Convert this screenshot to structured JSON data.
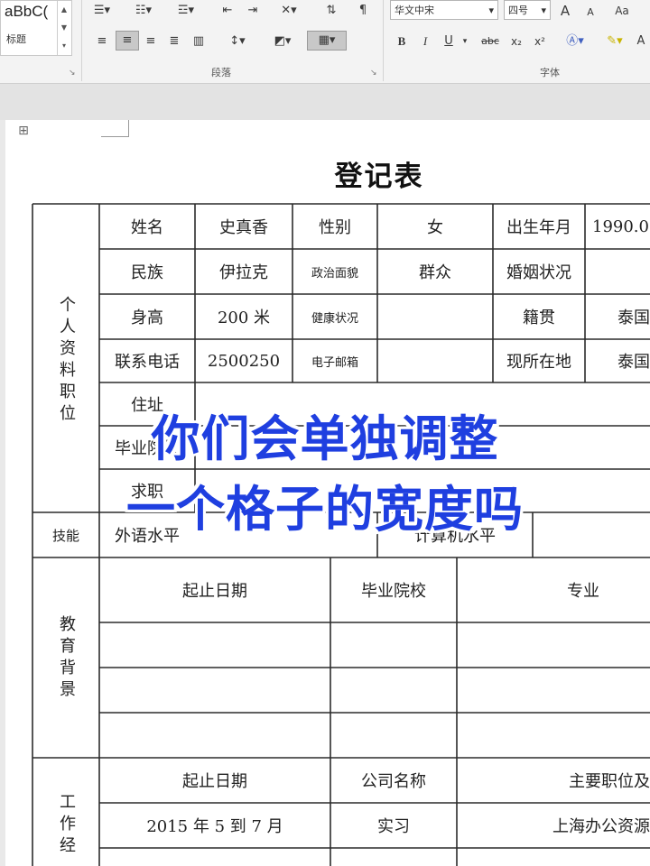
{
  "ribbon": {
    "style_gallery": {
      "sample": "aBbC(",
      "name": "标题"
    },
    "font": {
      "name": "华文中宋",
      "size": "四号"
    },
    "format_buttons": {
      "bold": "B",
      "italic": "I",
      "underline": "U",
      "strike": "abc",
      "subscript": "x₂",
      "superscript": "x²",
      "grow": "A",
      "shrink": "A",
      "case": "Aa"
    },
    "group_labels": {
      "paragraph": "段落",
      "font": "字体"
    }
  },
  "document": {
    "title": "登记表",
    "sections": {
      "personal": "个人资料职位",
      "skills": "技能",
      "education": "教育背景",
      "work": "工作经"
    },
    "personal_rows": [
      {
        "l1": "姓名",
        "v1": "史真香",
        "l2": "性别",
        "v2": "女",
        "l3": "出生年月",
        "v3": "1990.0"
      },
      {
        "l1": "民族",
        "v1": "伊拉克",
        "l2": "政治面貌",
        "v2": "群众",
        "l3": "婚姻状况",
        "v3": ""
      },
      {
        "l1": "身高",
        "v1": "200 米",
        "l2": "健康状况",
        "v2": "",
        "l3": "籍贯",
        "v3": "泰国"
      },
      {
        "l1": "联系电话",
        "v1": "2500250",
        "l2": "电子邮箱",
        "v2": "",
        "l3": "现所在地",
        "v3": "泰国"
      }
    ],
    "partial_rows": [
      "住址",
      "毕业院校",
      "求职"
    ],
    "skills_row": {
      "foreign": "外语水平",
      "computer": "计算机水平"
    },
    "education_headers": [
      "起止日期",
      "毕业院校",
      "专业"
    ],
    "work_headers": [
      "起止日期",
      "公司名称",
      "主要职位及"
    ],
    "work_rows": [
      {
        "date": "2015 年 5 到 7 月",
        "company": "实习",
        "role": "上海办公资源"
      }
    ]
  },
  "overlay": {
    "line1": "你们会单独调整",
    "line2": "一个格子的宽度吗"
  }
}
